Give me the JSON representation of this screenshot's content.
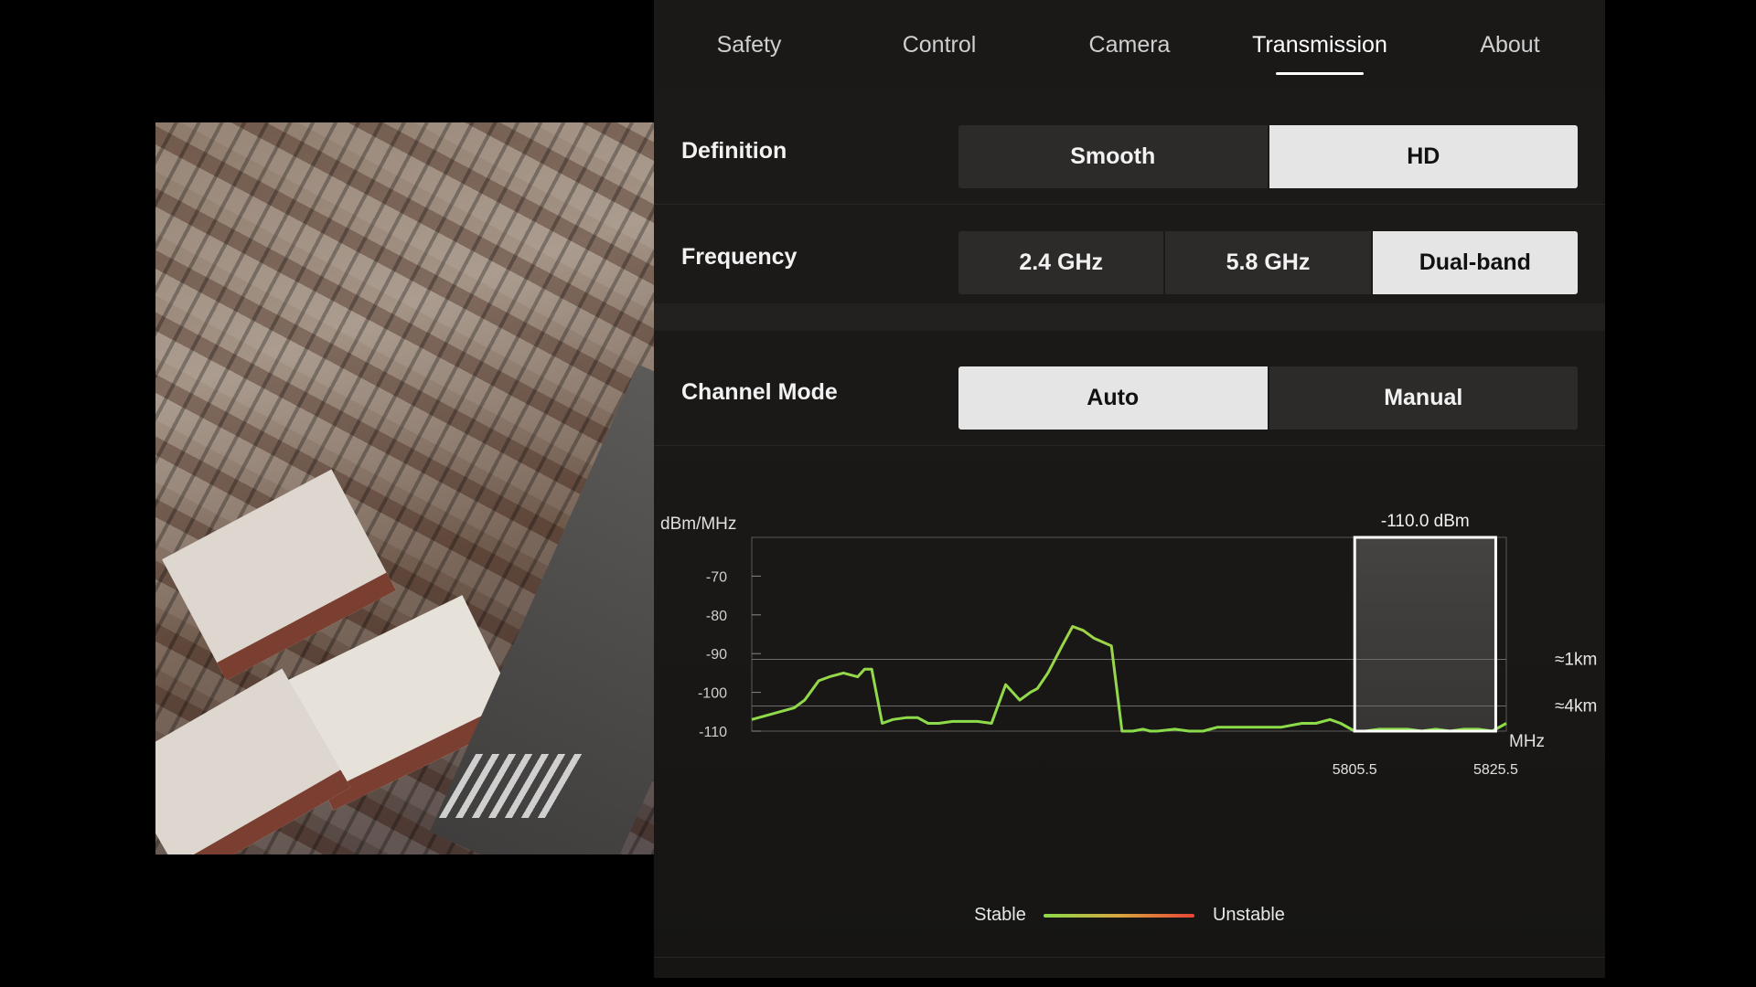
{
  "tabs": [
    {
      "label": "Safety"
    },
    {
      "label": "Control"
    },
    {
      "label": "Camera"
    },
    {
      "label": "Transmission",
      "active": true
    },
    {
      "label": "About"
    }
  ],
  "definition": {
    "label": "Definition",
    "options": [
      "Smooth",
      "HD"
    ],
    "selected": "HD"
  },
  "frequency": {
    "label": "Frequency",
    "options": [
      "2.4 GHz",
      "5.8 GHz",
      "Dual-band"
    ],
    "selected": "Dual-band"
  },
  "channel_mode": {
    "label": "Channel Mode",
    "options": [
      "Auto",
      "Manual"
    ],
    "selected": "Auto"
  },
  "legend": {
    "stable": "Stable",
    "unstable": "Unstable"
  },
  "colors": {
    "stable": "#8bdc4a",
    "mid": "#d8a640",
    "unstable": "#e84536",
    "selected": "#e5e5e5"
  },
  "chart_data": {
    "type": "line",
    "ylabel": "dBm/MHz",
    "xlabel": "MHz",
    "ylim": [
      -110,
      -60
    ],
    "yticks": [
      -70,
      -80,
      -90,
      -100,
      -110
    ],
    "xticks": [
      {
        "label": "5805.5",
        "value": 5805.5
      },
      {
        "label": "5825.5",
        "value": 5825.5
      }
    ],
    "xlim": [
      5720,
      5827
    ],
    "reference_lines": [
      {
        "value": -91.5,
        "label": "≈1km"
      },
      {
        "value": -103.5,
        "label": "≈4km"
      }
    ],
    "selected_channel": {
      "from": 5805.5,
      "to": 5825.5,
      "label": "-110.0 dBm"
    },
    "series": [
      {
        "x": [
          5720,
          5726,
          5727.5,
          5729.5,
          5731,
          5733,
          5735,
          5736,
          5737,
          5738.5,
          5740,
          5742,
          5743.5,
          5745,
          5746.5,
          5748.5,
          5750,
          5752,
          5754,
          5756,
          5758,
          5759.5,
          5760.5,
          5762,
          5764,
          5765.5,
          5767,
          5768.5,
          5771,
          5772.5,
          5774,
          5775.5,
          5776.5,
          5777.5,
          5780,
          5782,
          5784,
          5786,
          5788,
          5790,
          5792,
          5795,
          5798,
          5800,
          5802,
          5803.5,
          5805.5,
          5807,
          5809,
          5811,
          5813,
          5815,
          5817,
          5819,
          5821,
          5823,
          5825,
          5827
        ],
        "y": [
          -107,
          -104,
          -102,
          -97,
          -96,
          -95,
          -96,
          -94,
          -94,
          -108,
          -107,
          -106.5,
          -106.5,
          -108,
          -108,
          -107.5,
          -107.5,
          -107.5,
          -108,
          -98,
          -102,
          -100,
          -99,
          -95,
          -88,
          -83,
          -84,
          -86,
          -88,
          -110,
          -110,
          -109.5,
          -110,
          -110,
          -109.5,
          -110,
          -110,
          -109,
          -109,
          -109,
          -109,
          -109,
          -108,
          -108,
          -107,
          -108,
          -110,
          -110,
          -109.5,
          -109.5,
          -109.5,
          -110,
          -109.5,
          -110,
          -109.5,
          -109.5,
          -110,
          -108
        ]
      }
    ]
  }
}
